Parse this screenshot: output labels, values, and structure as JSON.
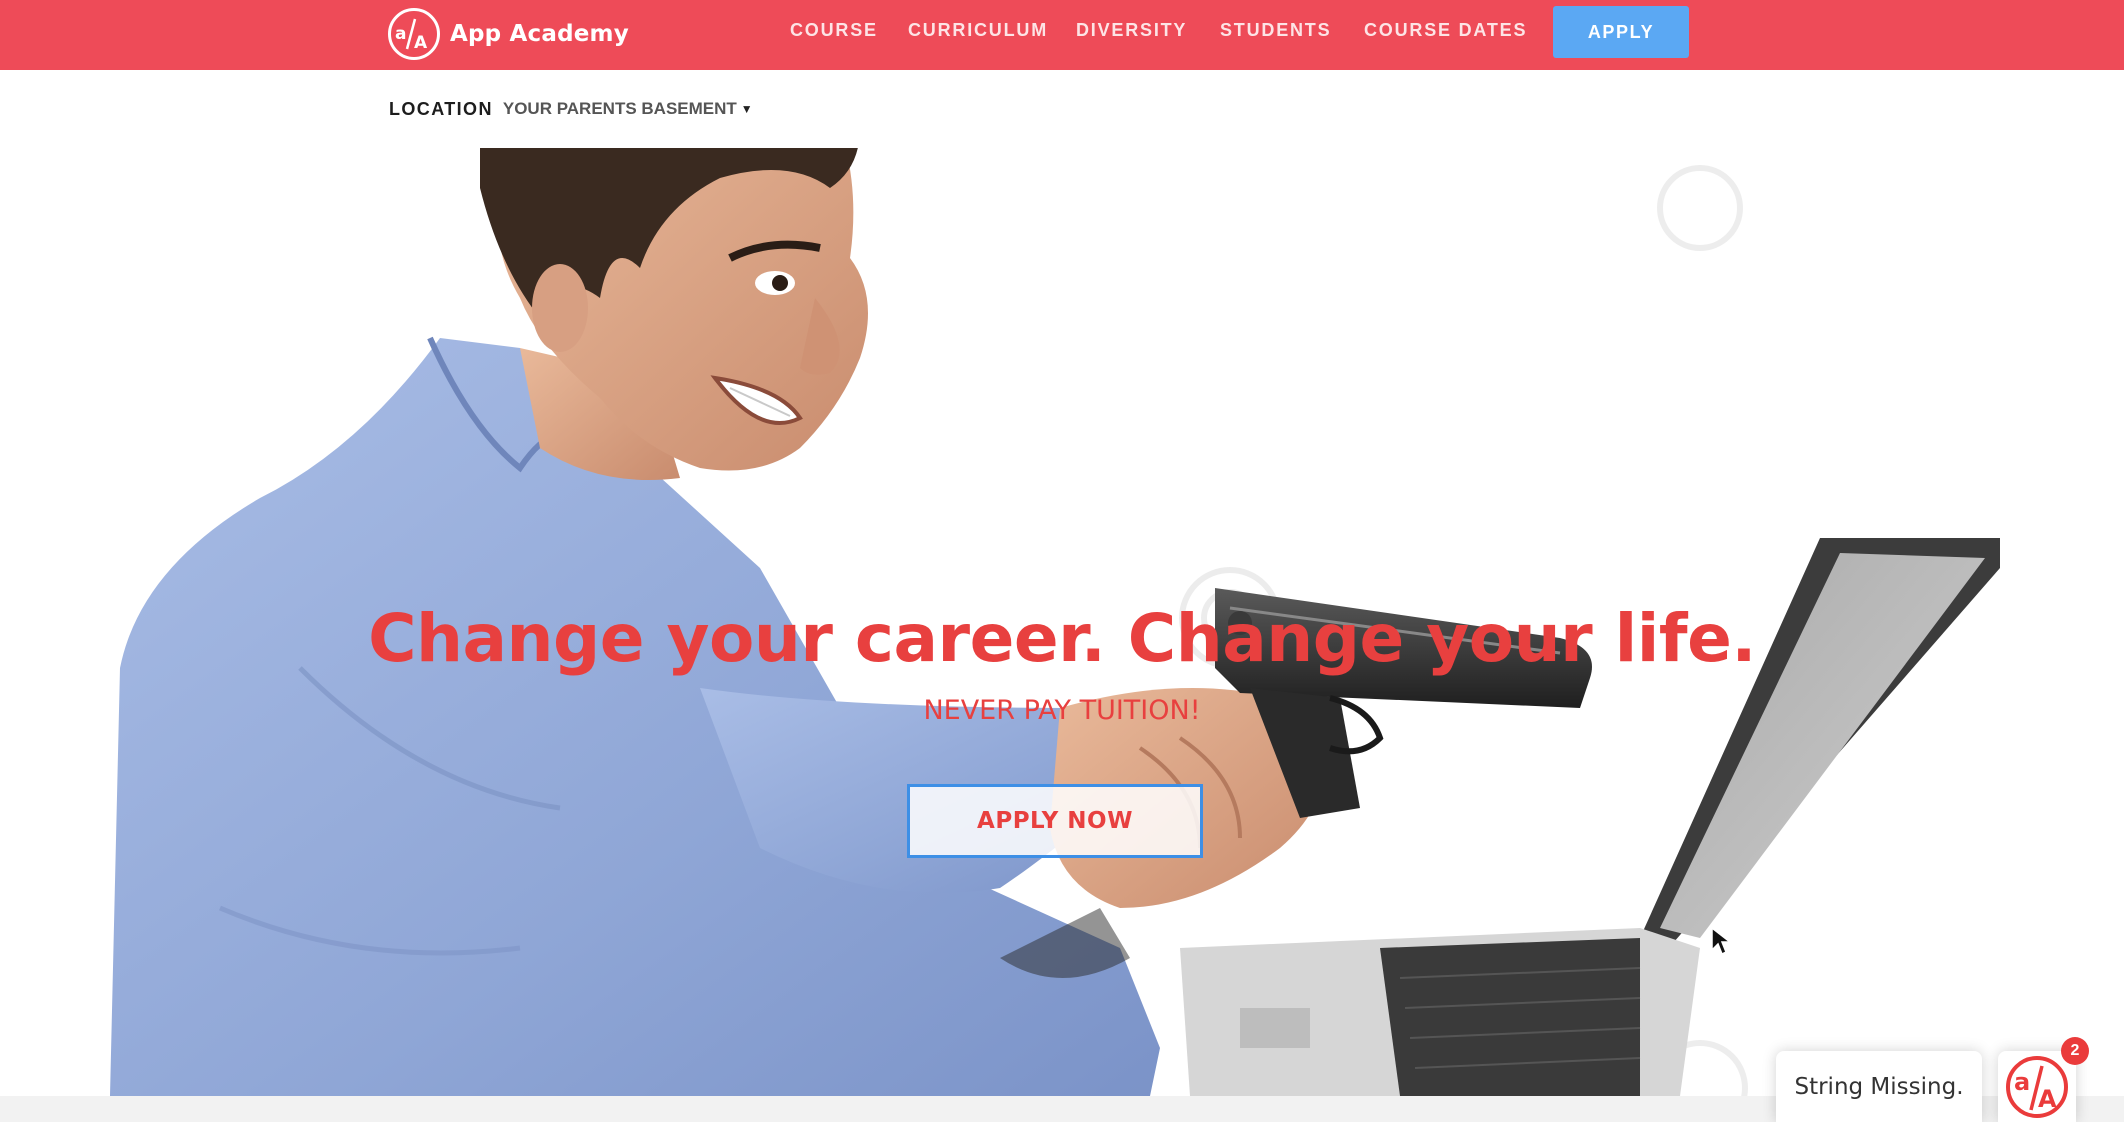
{
  "brand": {
    "name": "App Academy",
    "logo_glyph": "a/A",
    "primary_color": "#ee4b58",
    "accent_blue": "#5ba8f3",
    "headline_red": "#e8403f"
  },
  "nav": {
    "items": [
      {
        "label": "COURSE"
      },
      {
        "label": "CURRICULUM"
      },
      {
        "label": "DIVERSITY"
      },
      {
        "label": "STUDENTS"
      },
      {
        "label": "COURSE DATES"
      }
    ],
    "apply_label": "APPLY"
  },
  "location": {
    "label": "LOCATION",
    "selected": "YOUR PARENTS BASEMENT",
    "caret_icon": "caret-down-icon"
  },
  "hero": {
    "headline": "Change your career. Change your life.",
    "subheadline": "NEVER PAY TUITION!",
    "cta_label": "APPLY NOW"
  },
  "chat": {
    "message": "String Missing.",
    "badge_count": "2",
    "launcher_icon": "app-academy-logo-icon"
  }
}
